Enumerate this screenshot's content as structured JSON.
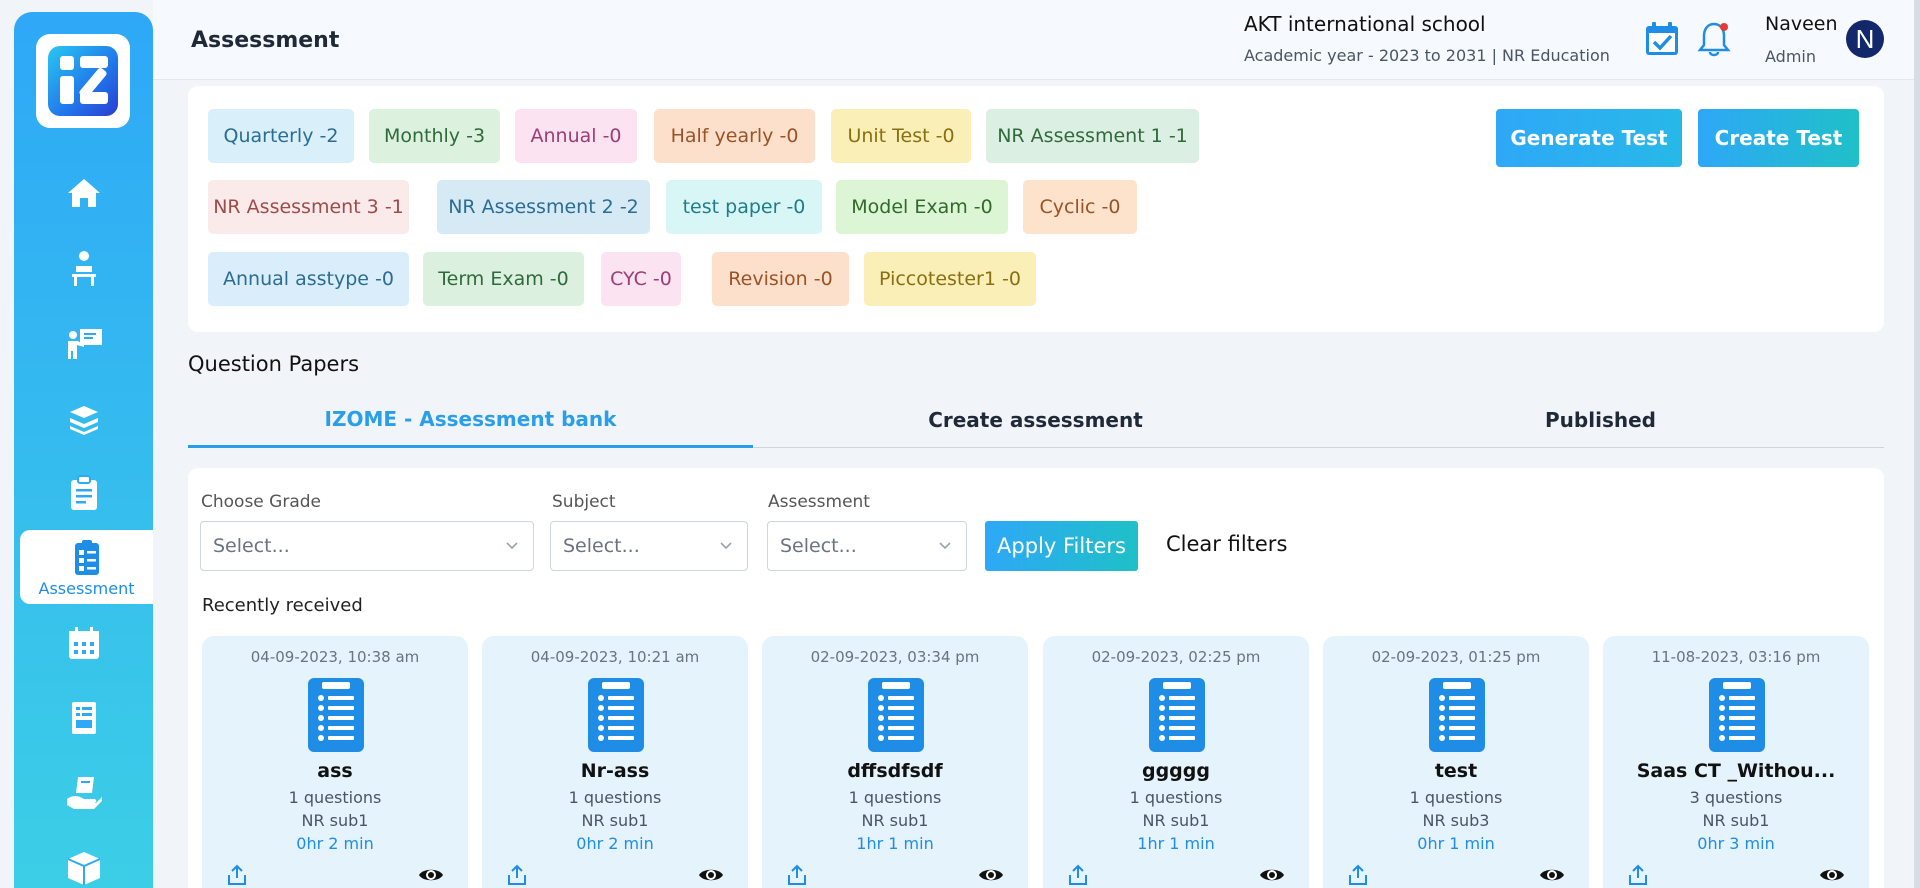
{
  "header": {
    "page_title": "Assessment",
    "school_name": "AKT international school",
    "academic_year": "Academic year - 2023 to 2031 | NR Education",
    "user_name": "Naveen",
    "user_role": "Admin",
    "avatar_initial": "N"
  },
  "sidebar": {
    "active_label": "Assessment",
    "icons": [
      "home-icon",
      "student-desk-icon",
      "teacher-board-icon",
      "books-icon",
      "clipboard-icon",
      "assessment-icon",
      "calendar-icon",
      "report-card-icon",
      "book-hand-icon",
      "package-icon"
    ]
  },
  "types": [
    {
      "label": "Quarterly -2",
      "bg": "#d9effa",
      "fg": "#2b6c94"
    },
    {
      "label": "Monthly -3",
      "bg": "#dcf2df",
      "fg": "#2f6b3a"
    },
    {
      "label": "Annual -0",
      "bg": "#fbe3f1",
      "fg": "#9b3e75"
    },
    {
      "label": "Half yearly -0",
      "bg": "#fde0cb",
      "fg": "#9b5226"
    },
    {
      "label": "Unit Test -0",
      "bg": "#faefb6",
      "fg": "#8a6e12"
    },
    {
      "label": "NR Assessment 1 -1",
      "bg": "#dcefe3",
      "fg": "#2f6b3a"
    },
    {
      "label": "NR Assessment 3 -1",
      "bg": "#faeaea",
      "fg": "#a04a4a"
    },
    {
      "label": "NR Assessment 2 -2",
      "bg": "#d6eaf6",
      "fg": "#2b6c94"
    },
    {
      "label": "test paper -0",
      "bg": "#d9f6f6",
      "fg": "#1f7d8a"
    },
    {
      "label": "Model Exam -0",
      "bg": "#dcf5d5",
      "fg": "#2f6b2a"
    },
    {
      "label": "Cyclic -0",
      "bg": "#fde2cc",
      "fg": "#9b5226"
    },
    {
      "label": "Annual asstype -0",
      "bg": "#d9eefa",
      "fg": "#2b6c94"
    },
    {
      "label": "Term Exam -0",
      "bg": "#dcf0e0",
      "fg": "#2f6b3a"
    },
    {
      "label": "CYC -0",
      "bg": "#fbe3f1",
      "fg": "#9b3e75"
    },
    {
      "label": "Revision -0",
      "bg": "#fde0cb",
      "fg": "#9b5226"
    },
    {
      "label": "Piccotester1 -0",
      "bg": "#faefb6",
      "fg": "#8a6e12"
    }
  ],
  "actions": {
    "generate_test": "Generate Test",
    "create_test": "Create Test"
  },
  "question_papers": {
    "title": "Question Papers",
    "tabs": [
      "IZOME - Assessment bank",
      "Create assessment",
      "Published"
    ],
    "active_tab": "IZOME - Assessment bank"
  },
  "filters": {
    "grade_label": "Choose Grade",
    "grade_placeholder": "Select...",
    "subject_label": "Subject",
    "subject_placeholder": "Select...",
    "assessment_label": "Assessment",
    "assessment_placeholder": "Select...",
    "apply": "Apply Filters",
    "clear": "Clear filters"
  },
  "recent_title": "Recently received",
  "cards": [
    {
      "date": "04-09-2023, 10:38 am",
      "name": "ass",
      "questions": "1 questions",
      "subject": "NR sub1",
      "duration": "0hr 2 min"
    },
    {
      "date": "04-09-2023, 10:21 am",
      "name": "Nr-ass",
      "questions": "1 questions",
      "subject": "NR sub1",
      "duration": "0hr 2 min"
    },
    {
      "date": "02-09-2023, 03:34 pm",
      "name": "dffsdfsdf",
      "questions": "1 questions",
      "subject": "NR sub1",
      "duration": "1hr 1 min"
    },
    {
      "date": "02-09-2023, 02:25 pm",
      "name": "ggggg",
      "questions": "1 questions",
      "subject": "NR sub1",
      "duration": "1hr 1 min"
    },
    {
      "date": "02-09-2023, 01:25 pm",
      "name": "test",
      "questions": "1 questions",
      "subject": "NR sub3",
      "duration": "0hr 1 min"
    },
    {
      "date": "11-08-2023, 03:16 pm",
      "name": "Saas CT _Withou...",
      "questions": "3 questions",
      "subject": "NR sub1",
      "duration": "0hr 3 min"
    }
  ]
}
